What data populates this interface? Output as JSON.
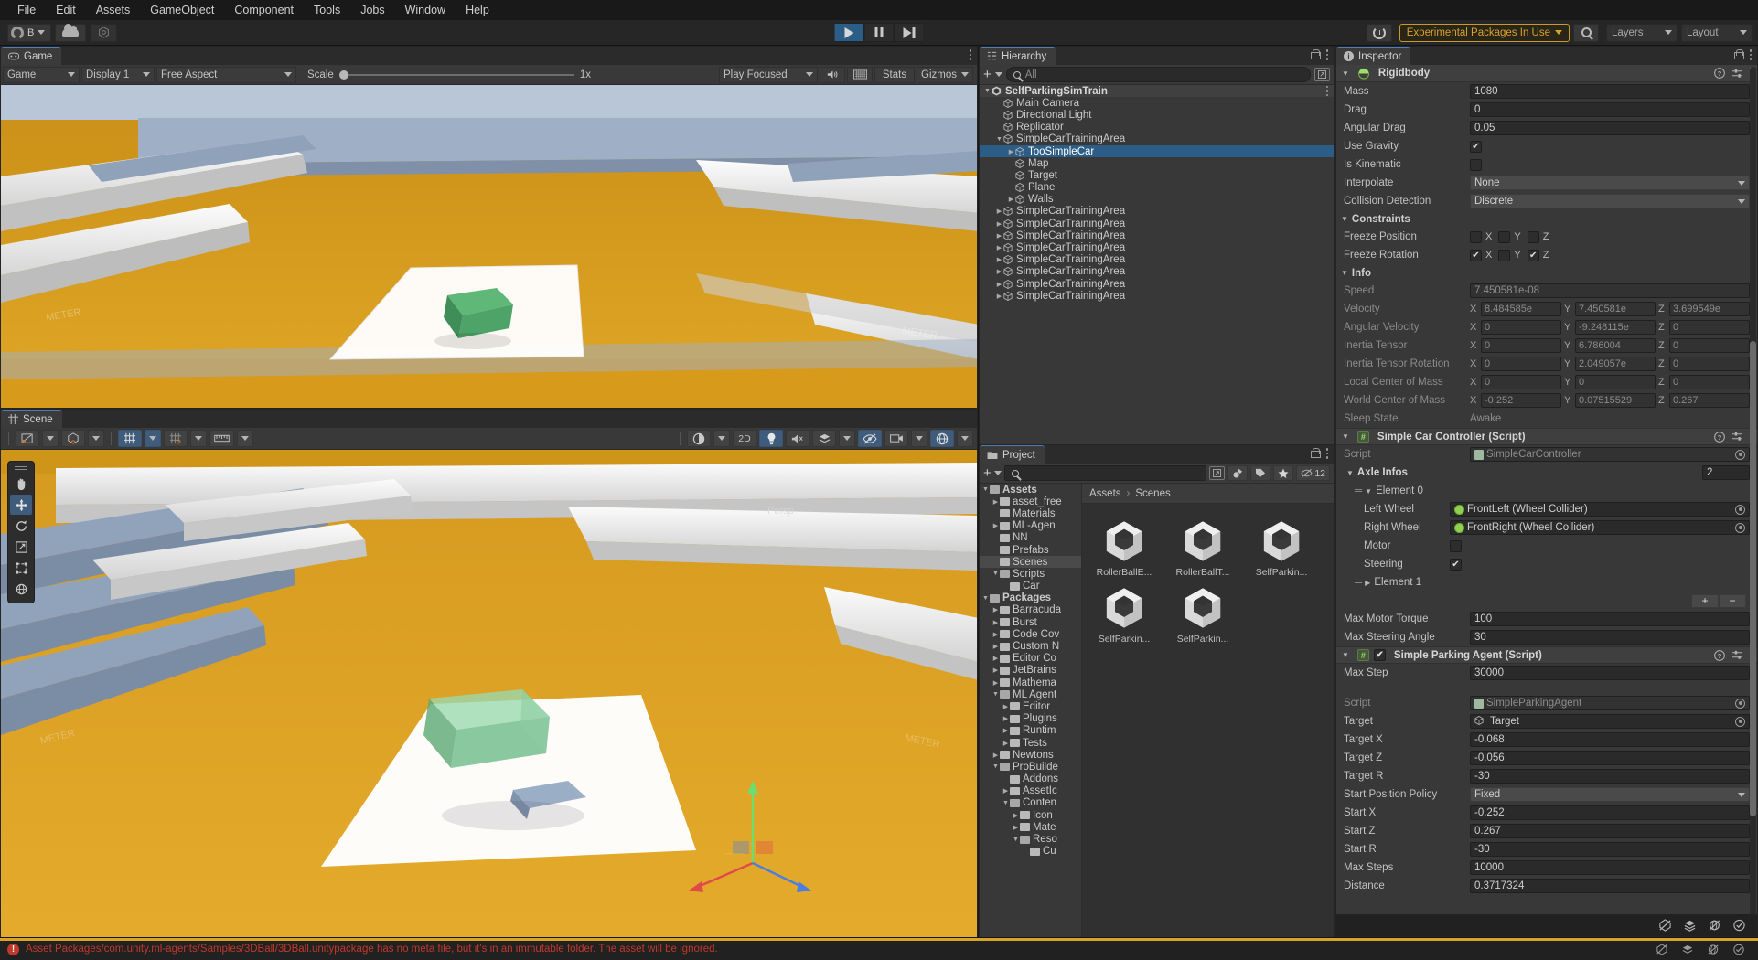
{
  "menu": {
    "items": [
      "File",
      "Edit",
      "Assets",
      "GameObject",
      "Component",
      "Tools",
      "Jobs",
      "Window",
      "Help"
    ]
  },
  "toolbar": {
    "account_label": "B",
    "account_icon": "person-icon",
    "cloud_icon": "cloud-icon",
    "collab_icon": "collab-icon",
    "play_icon": "play-icon",
    "pause_icon": "pause-icon",
    "step_icon": "step-icon",
    "history_icon": "history-icon",
    "experimental_badge": "Experimental Packages In Use",
    "search_icon": "search-icon",
    "layers_label": "Layers",
    "layout_label": "Layout"
  },
  "game_view": {
    "tab_label": "Game",
    "tab_icon": "gamepad-icon",
    "mode": "Game",
    "display": "Display 1",
    "aspect": "Free Aspect",
    "scale_label": "Scale",
    "scale_value": "1x",
    "play_mode": "Play Focused",
    "mute_icon": "speaker-icon",
    "keyboard_icon": "keyboard-icon",
    "stats_label": "Stats",
    "gizmos_label": "Gizmos"
  },
  "scene_view": {
    "tab_label": "Scene",
    "tab_icon": "scene-grid-icon",
    "tools": [
      {
        "name": "hand-tool",
        "icon": "✋",
        "active": false
      },
      {
        "name": "move-tool",
        "icon": "✥",
        "active": true
      },
      {
        "name": "rotate-tool",
        "icon": "⟳",
        "active": false
      },
      {
        "name": "scale-tool",
        "icon": "⬈",
        "active": false
      },
      {
        "name": "rect-tool",
        "icon": "⬚",
        "active": false
      },
      {
        "name": "transform-tool",
        "icon": "◍",
        "active": false
      }
    ],
    "toolbar_right": {
      "shading_label": "shading-mode",
      "twod_label": "2D",
      "lighting_icon": "lightbulb-icon",
      "audio_icon": "audio-mute-icon",
      "fx_icon": "effects-icon",
      "hidden_icon": "hidden-objects-icon",
      "camera_icon": "scene-camera-icon",
      "gizmo_icon": "gizmo-visibility-icon"
    },
    "persp_label": "Persp"
  },
  "hierarchy": {
    "tab_label": "Hierarchy",
    "tab_icon": "hierarchy-icon",
    "search_placeholder": "All",
    "search_value": "",
    "items": [
      {
        "label": "SelfParkingSimTrain",
        "depth": 0,
        "arrow": "down",
        "icon": "unity-scene-icon",
        "selected": false,
        "root": true
      },
      {
        "label": "Main Camera",
        "depth": 1,
        "arrow": "none",
        "icon": "gameobject-icon",
        "selected": false
      },
      {
        "label": "Directional Light",
        "depth": 1,
        "arrow": "none",
        "icon": "gameobject-icon",
        "selected": false
      },
      {
        "label": "Replicator",
        "depth": 1,
        "arrow": "none",
        "icon": "gameobject-icon",
        "selected": false
      },
      {
        "label": "SimpleCarTrainingArea",
        "depth": 1,
        "arrow": "down",
        "icon": "gameobject-icon",
        "selected": false
      },
      {
        "label": "TooSimpleCar",
        "depth": 2,
        "arrow": "right",
        "icon": "gameobject-icon",
        "selected": true
      },
      {
        "label": "Map",
        "depth": 2,
        "arrow": "none",
        "icon": "gameobject-icon",
        "selected": false
      },
      {
        "label": "Target",
        "depth": 2,
        "arrow": "none",
        "icon": "gameobject-icon",
        "selected": false
      },
      {
        "label": "Plane",
        "depth": 2,
        "arrow": "none",
        "icon": "gameobject-icon",
        "selected": false
      },
      {
        "label": "Walls",
        "depth": 2,
        "arrow": "right",
        "icon": "gameobject-icon",
        "selected": false
      },
      {
        "label": "SimpleCarTrainingArea",
        "depth": 1,
        "arrow": "right",
        "icon": "gameobject-icon",
        "selected": false
      },
      {
        "label": "SimpleCarTrainingArea",
        "depth": 1,
        "arrow": "right",
        "icon": "gameobject-icon",
        "selected": false
      },
      {
        "label": "SimpleCarTrainingArea",
        "depth": 1,
        "arrow": "right",
        "icon": "gameobject-icon",
        "selected": false
      },
      {
        "label": "SimpleCarTrainingArea",
        "depth": 1,
        "arrow": "right",
        "icon": "gameobject-icon",
        "selected": false
      },
      {
        "label": "SimpleCarTrainingArea",
        "depth": 1,
        "arrow": "right",
        "icon": "gameobject-icon",
        "selected": false
      },
      {
        "label": "SimpleCarTrainingArea",
        "depth": 1,
        "arrow": "right",
        "icon": "gameobject-icon",
        "selected": false
      },
      {
        "label": "SimpleCarTrainingArea",
        "depth": 1,
        "arrow": "right",
        "icon": "gameobject-icon",
        "selected": false
      },
      {
        "label": "SimpleCarTrainingArea",
        "depth": 1,
        "arrow": "right",
        "icon": "gameobject-icon",
        "selected": false
      }
    ]
  },
  "project": {
    "tab_label": "Project",
    "tab_icon": "folder-icon",
    "search_placeholder": "",
    "hidden_count": "12",
    "breadcrumb": [
      "Assets",
      "Scenes"
    ],
    "tree": [
      {
        "label": "Assets",
        "depth": 0,
        "arrow": "down",
        "open": true
      },
      {
        "label": "asset_free",
        "depth": 1,
        "arrow": "right"
      },
      {
        "label": "Materials",
        "depth": 1,
        "arrow": "none"
      },
      {
        "label": "ML-Agen",
        "depth": 1,
        "arrow": "right"
      },
      {
        "label": "NN",
        "depth": 1,
        "arrow": "none"
      },
      {
        "label": "Prefabs",
        "depth": 1,
        "arrow": "none"
      },
      {
        "label": "Scenes",
        "depth": 1,
        "arrow": "none",
        "selected": true
      },
      {
        "label": "Scripts",
        "depth": 1,
        "arrow": "down",
        "open": true
      },
      {
        "label": "Car",
        "depth": 2,
        "arrow": "none"
      },
      {
        "label": "Packages",
        "depth": 0,
        "arrow": "down",
        "open": true
      },
      {
        "label": "Barracuda",
        "depth": 1,
        "arrow": "right"
      },
      {
        "label": "Burst",
        "depth": 1,
        "arrow": "right"
      },
      {
        "label": "Code Cov",
        "depth": 1,
        "arrow": "right"
      },
      {
        "label": "Custom N",
        "depth": 1,
        "arrow": "right"
      },
      {
        "label": "Editor Co",
        "depth": 1,
        "arrow": "right"
      },
      {
        "label": "JetBrains",
        "depth": 1,
        "arrow": "right"
      },
      {
        "label": "Mathema",
        "depth": 1,
        "arrow": "right"
      },
      {
        "label": "ML Agent",
        "depth": 1,
        "arrow": "down",
        "open": true
      },
      {
        "label": "Editor",
        "depth": 2,
        "arrow": "right"
      },
      {
        "label": "Plugins",
        "depth": 2,
        "arrow": "right"
      },
      {
        "label": "Runtim",
        "depth": 2,
        "arrow": "right"
      },
      {
        "label": "Tests",
        "depth": 2,
        "arrow": "right"
      },
      {
        "label": "Newtons",
        "depth": 1,
        "arrow": "right"
      },
      {
        "label": "ProBuilde",
        "depth": 1,
        "arrow": "down",
        "open": true
      },
      {
        "label": "Addons",
        "depth": 2,
        "arrow": "none"
      },
      {
        "label": "AssetIc",
        "depth": 2,
        "arrow": "right"
      },
      {
        "label": "Conten",
        "depth": 2,
        "arrow": "down",
        "open": true
      },
      {
        "label": "Icon",
        "depth": 3,
        "arrow": "right"
      },
      {
        "label": "Mate",
        "depth": 3,
        "arrow": "right"
      },
      {
        "label": "Reso",
        "depth": 3,
        "arrow": "down",
        "open": true
      },
      {
        "label": "Cu",
        "depth": 4,
        "arrow": "none"
      }
    ],
    "assets": [
      {
        "label": "RollerBallE...",
        "icon": "unity-scene-asset"
      },
      {
        "label": "RollerBallT...",
        "icon": "unity-scene-asset"
      },
      {
        "label": "SelfParkin...",
        "icon": "unity-scene-asset"
      },
      {
        "label": "SelfParkin...",
        "icon": "unity-scene-asset"
      },
      {
        "label": "SelfParkin...",
        "icon": "unity-scene-asset"
      }
    ]
  },
  "inspector": {
    "tab_label": "Inspector",
    "tab_icon": "info-icon",
    "components": [
      {
        "name": "Rigidbody",
        "icon": "rigidbody-icon",
        "rows": [
          {
            "type": "field",
            "label": "Mass",
            "value": "1080"
          },
          {
            "type": "field",
            "label": "Drag",
            "value": "0"
          },
          {
            "type": "field",
            "label": "Angular Drag",
            "value": "0.05"
          },
          {
            "type": "check",
            "label": "Use Gravity",
            "checked": true
          },
          {
            "type": "check",
            "label": "Is Kinematic",
            "checked": false
          },
          {
            "type": "popup",
            "label": "Interpolate",
            "value": "None"
          },
          {
            "type": "popup",
            "label": "Collision Detection",
            "value": "Discrete"
          },
          {
            "type": "foldout",
            "label": "Constraints"
          },
          {
            "type": "axischeck",
            "label": "Freeze Position",
            "x": false,
            "y": false,
            "z": false
          },
          {
            "type": "axischeck",
            "label": "Freeze Rotation",
            "x": true,
            "y": false,
            "z": true
          },
          {
            "type": "foldout",
            "label": "Info"
          },
          {
            "type": "field",
            "label": "Speed",
            "value": "7.450581e-08",
            "dim": true
          },
          {
            "type": "vec3",
            "label": "Velocity",
            "x": "8.484585e",
            "y": "7.450581e",
            "z": "3.699549e",
            "dim": true
          },
          {
            "type": "vec3",
            "label": "Angular Velocity",
            "x": "0",
            "y": "-9.248115e",
            "z": "0",
            "dim": true
          },
          {
            "type": "vec3",
            "label": "Inertia Tensor",
            "x": "0",
            "y": "6.786004",
            "z": "0",
            "dim": true
          },
          {
            "type": "vec3",
            "label": "Inertia Tensor Rotation",
            "x": "0",
            "y": "2.049057e",
            "z": "0",
            "dim": true
          },
          {
            "type": "vec3",
            "label": "Local Center of Mass",
            "x": "0",
            "y": "0",
            "z": "0",
            "dim": true
          },
          {
            "type": "vec3",
            "label": "World Center of Mass",
            "x": "-0.252",
            "y": "0.07515529",
            "z": "0.267",
            "dim": true
          },
          {
            "type": "text",
            "label": "Sleep State",
            "value": "Awake",
            "dim": true
          }
        ]
      },
      {
        "name": "Simple Car Controller (Script)",
        "icon": "csharp-script-icon",
        "rows": [
          {
            "type": "object",
            "label": "Script",
            "value": "SimpleCarController",
            "dim": true
          },
          {
            "type": "arrayheader",
            "label": "Axle Infos",
            "size": "2"
          },
          {
            "type": "element",
            "label": "Element 0",
            "expanded": true
          },
          {
            "type": "objwheel",
            "label": "Left Wheel",
            "value": "FrontLeft (Wheel Collider)"
          },
          {
            "type": "objwheel",
            "label": "Right Wheel",
            "value": "FrontRight (Wheel Collider)"
          },
          {
            "type": "check2",
            "label": "Motor",
            "checked": false
          },
          {
            "type": "check2",
            "label": "Steering",
            "checked": true
          },
          {
            "type": "element",
            "label": "Element 1",
            "expanded": false
          },
          {
            "type": "plusminus"
          },
          {
            "type": "field",
            "label": "Max Motor Torque",
            "value": "100"
          },
          {
            "type": "field",
            "label": "Max Steering Angle",
            "value": "30"
          }
        ]
      },
      {
        "name": "Simple Parking Agent (Script)",
        "icon": "csharp-script-icon",
        "enabled": true,
        "rows": [
          {
            "type": "field",
            "label": "Max Step",
            "value": "30000"
          },
          {
            "type": "divider"
          },
          {
            "type": "object",
            "label": "Script",
            "value": "SimpleParkingAgent",
            "dim": true
          },
          {
            "type": "objgo",
            "label": "Target",
            "value": "Target"
          },
          {
            "type": "field",
            "label": "Target X",
            "value": "-0.068"
          },
          {
            "type": "field",
            "label": "Target Z",
            "value": "-0.056"
          },
          {
            "type": "field",
            "label": "Target R",
            "value": "-30"
          },
          {
            "type": "popup",
            "label": "Start Position Policy",
            "value": "Fixed"
          },
          {
            "type": "field",
            "label": "Start X",
            "value": "-0.252"
          },
          {
            "type": "field",
            "label": "Start Z",
            "value": "0.267"
          },
          {
            "type": "field",
            "label": "Start R",
            "value": "-30"
          },
          {
            "type": "field",
            "label": "Max Steps",
            "value": "10000"
          },
          {
            "type": "field",
            "label": "Distance",
            "value": "0.3717324"
          }
        ]
      }
    ],
    "footer_icons": [
      "no-collider-icon",
      "layers-stack-icon",
      "no-visibility-icon",
      "check-circle-icon"
    ]
  },
  "status": {
    "error_icon": "error-icon",
    "message": "Asset Packages/com.unity.ml-agents/Samples/3DBall/3DBall.unitypackage has no meta file, but it's in an immutable folder. The asset will be ignored."
  },
  "colors": {
    "accent_blue": "#2c5d87",
    "warning_amber": "#d7a22b",
    "error_red": "#c0392b",
    "ground_orange": "#d89a1a",
    "panel_bg": "#383838"
  }
}
